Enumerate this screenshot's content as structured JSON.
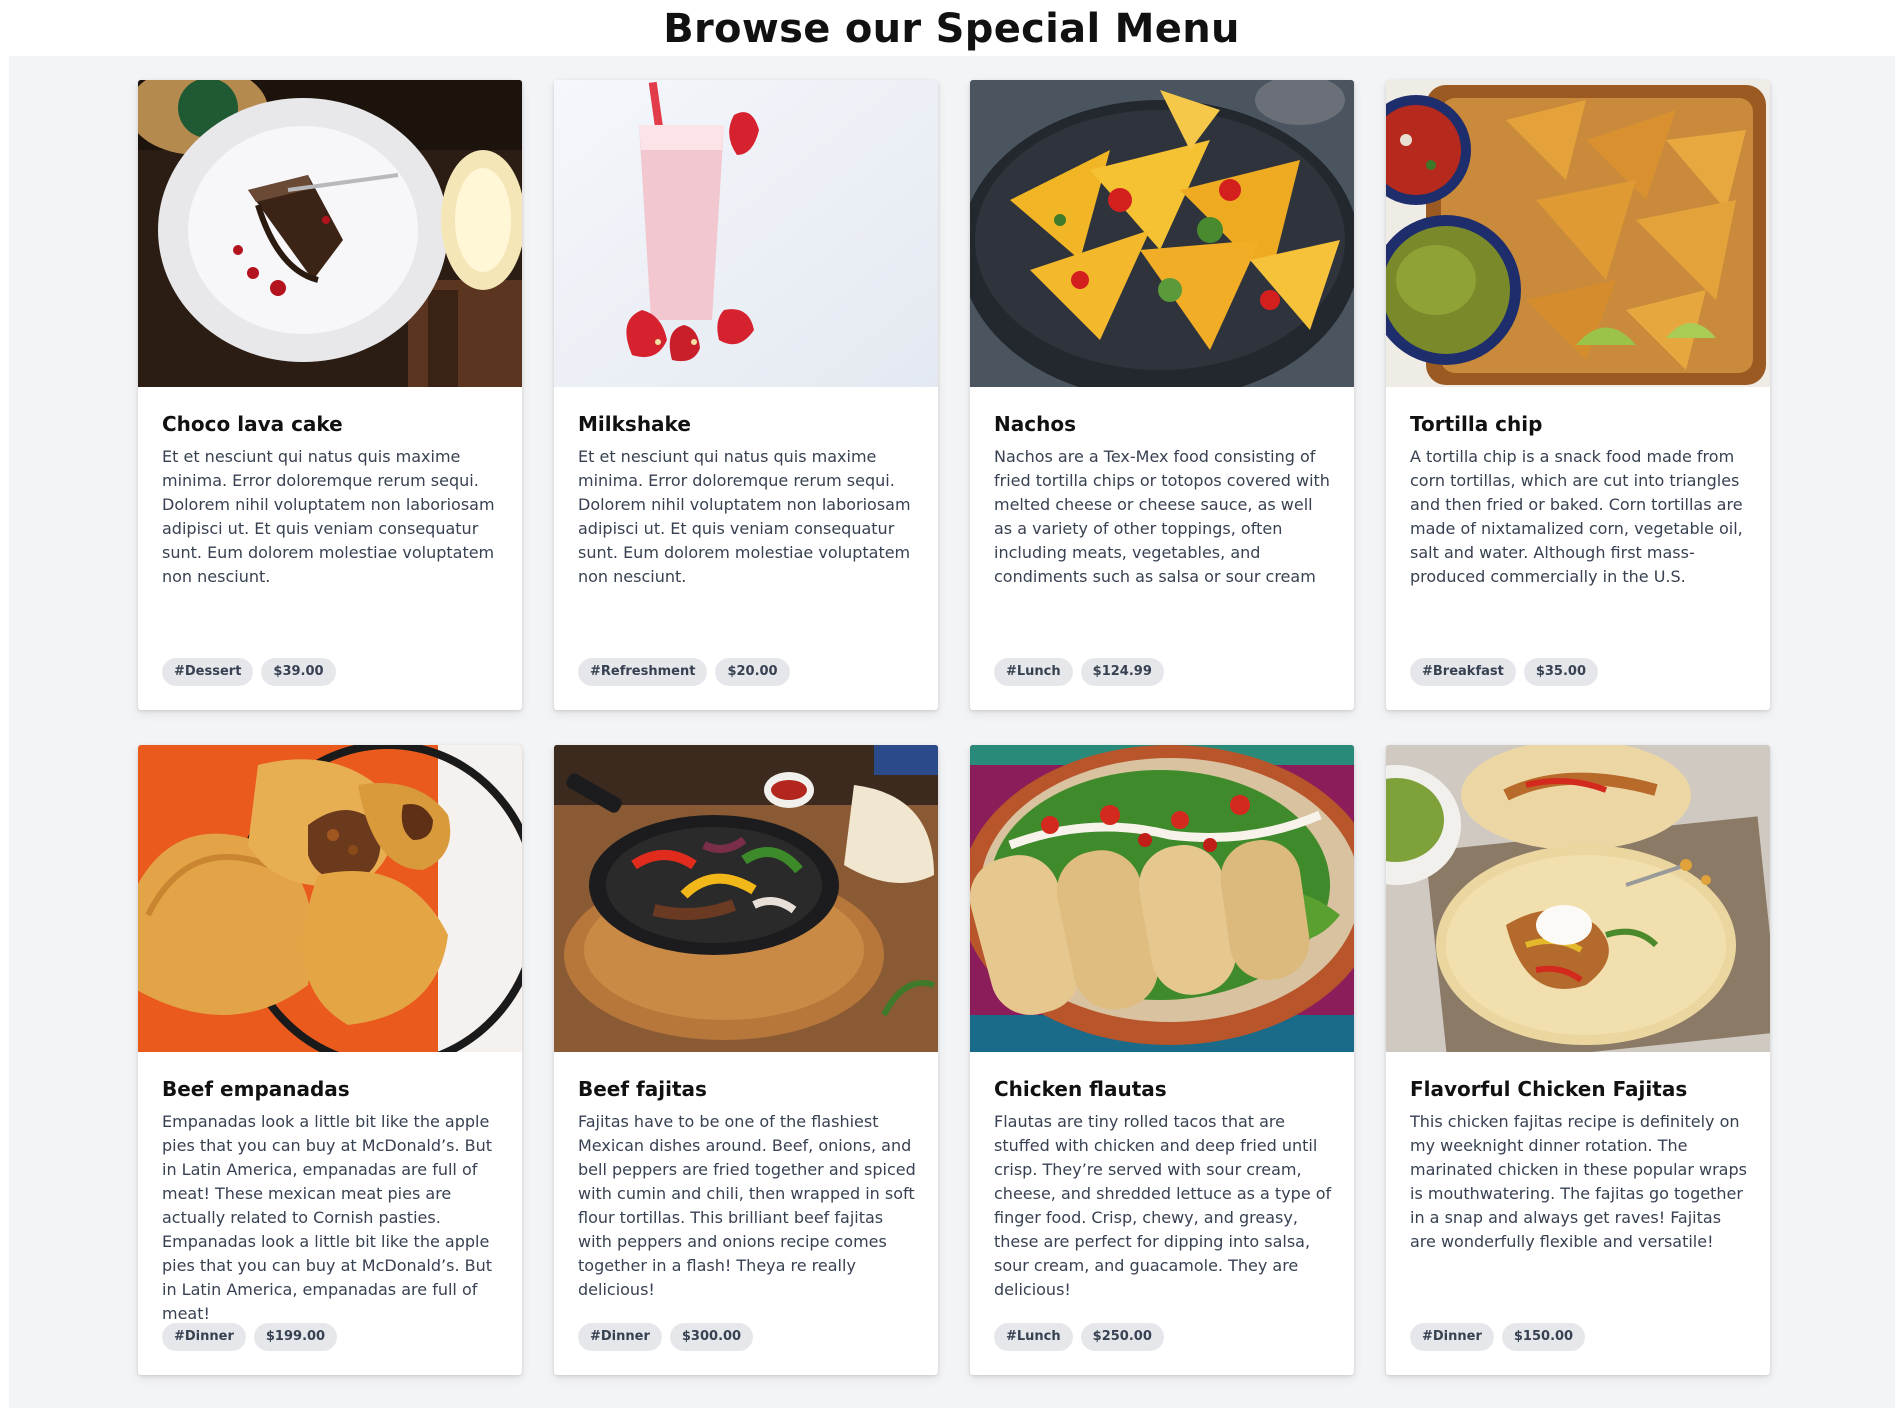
{
  "page": {
    "title": "Browse our Special Menu"
  },
  "menu": {
    "items": [
      {
        "image_name": "choco-lava-cake-image",
        "title": "Choco lava cake",
        "description": "Et et nesciunt qui natus quis maxime minima. Error doloremque rerum sequi. Dolorem nihil voluptatem non laboriosam adipisci ut. Et quis veniam consequatur sunt. Eum dolorem molestiae voluptatem non nesciunt.",
        "tag": "#Dessert",
        "price": "$39.00"
      },
      {
        "image_name": "milkshake-image",
        "title": "Milkshake",
        "description": "Et et nesciunt qui natus quis maxime minima. Error doloremque rerum sequi. Dolorem nihil voluptatem non laboriosam adipisci ut. Et quis veniam consequatur sunt. Eum dolorem molestiae voluptatem non nesciunt.",
        "tag": "#Refreshment",
        "price": "$20.00"
      },
      {
        "image_name": "nachos-image",
        "title": "Nachos",
        "description": "Nachos are a Tex-Mex food consisting of fried tortilla chips or totopos covered with melted cheese or cheese sauce, as well as a variety of other toppings, often including meats, vegetables, and condiments such as salsa or sour cream",
        "tag": "#Lunch",
        "price": "$124.99"
      },
      {
        "image_name": "tortilla-chip-image",
        "title": "Tortilla chip",
        "description": "A tortilla chip is a snack food made from corn tortillas, which are cut into triangles and then fried or baked. Corn tortillas are made of nixtamalized corn, vegetable oil, salt and water. Although first mass-produced commercially in the U.S.",
        "tag": "#Breakfast",
        "price": "$35.00"
      },
      {
        "image_name": "beef-empanadas-image",
        "title": "Beef empanadas",
        "description": "Empanadas look a little bit like the apple pies that you can buy at McDonald’s. But in Latin America, empanadas are full of meat! These mexican meat pies are actually related to Cornish pasties.  Empanadas look a little bit like the apple pies that you can buy at McDonald’s. But in Latin America, empanadas are full of meat!",
        "tag": "#Dinner",
        "price": "$199.00"
      },
      {
        "image_name": "beef-fajitas-image",
        "title": "Beef fajitas",
        "description": "Fajitas have to be one of the flashiest Mexican dishes around. Beef, onions, and bell peppers are fried together and spiced with cumin and chili, then wrapped in soft flour tortillas. This brilliant beef fajitas with peppers and onions recipe comes together in a flash! Theya re really delicious!",
        "tag": "#Dinner",
        "price": "$300.00"
      },
      {
        "image_name": "chicken-flautas-image",
        "title": "Chicken flautas",
        "description": "Flautas are tiny rolled tacos that are stuffed with chicken and deep fried until crisp. They’re served with sour cream, cheese, and shredded lettuce as a type of finger food. Crisp, chewy, and greasy, these are perfect for dipping into salsa, sour cream, and guacamole. They are delicious!",
        "tag": "#Lunch",
        "price": "$250.00"
      },
      {
        "image_name": "chicken-fajitas-image",
        "title": "Flavorful Chicken Fajitas",
        "description": "This chicken fajitas recipe is definitely on my weeknight dinner rotation. The marinated chicken in these popular wraps is mouthwatering. The fajitas go together in a snap and always get raves! Fajitas are wonderfully flexible and versatile!",
        "tag": "#Dinner",
        "price": "$150.00"
      }
    ]
  }
}
